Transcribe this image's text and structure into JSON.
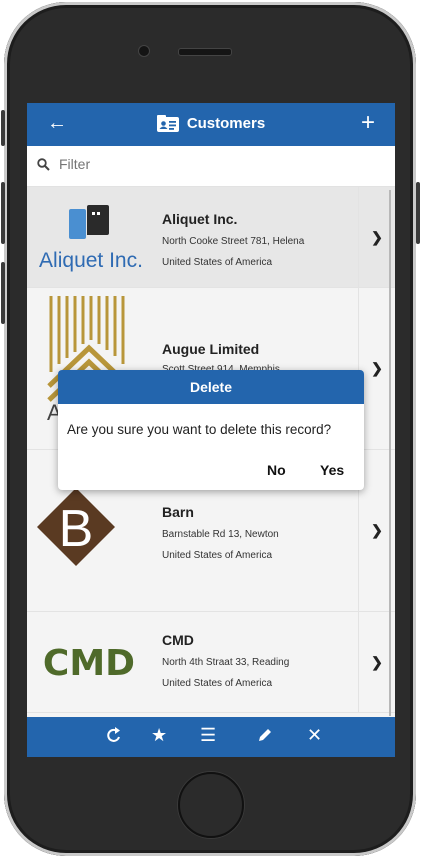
{
  "header": {
    "title": "Customers",
    "back_icon": "back-arrow-icon",
    "add_icon": "plus-icon",
    "title_icon": "contact-card-icon"
  },
  "filter": {
    "placeholder": "Filter"
  },
  "customers": [
    {
      "name": "Aliquet Inc.",
      "address": "North Cooke Street 781, Helena",
      "country": "United States of America",
      "logo_text": "Aliquet Inc."
    },
    {
      "name": "Augue Limited",
      "address": "Scott Street 914, Memphis",
      "country": "",
      "logo_text": "A"
    },
    {
      "name": "Barn",
      "address": "Barnstable Rd 13, Newton",
      "country": "United States of America",
      "logo_text": "B"
    },
    {
      "name": "CMD",
      "address": "North 4th Straat 33, Reading",
      "country": "United States of America",
      "logo_text": "CMD"
    }
  ],
  "dialog": {
    "title": "Delete",
    "message": "Are you sure you want to delete this record?",
    "no_label": "No",
    "yes_label": "Yes"
  },
  "toolbar": {
    "icons": [
      "refresh-icon",
      "star-icon",
      "menu-icon",
      "edit-icon",
      "close-icon"
    ]
  },
  "colors": {
    "primary": "#2365ad",
    "aliquet_blue": "#4a8fd1",
    "augue_gold": "#b8963a",
    "barn_brown": "#5a3a22",
    "cmd_green": "#4f6a2a"
  }
}
